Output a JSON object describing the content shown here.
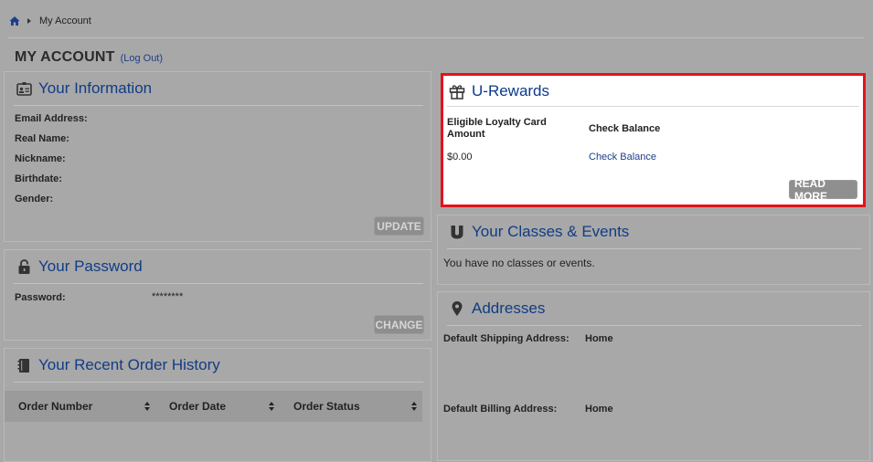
{
  "breadcrumb": {
    "current": "My Account"
  },
  "header": {
    "title": "MY ACCOUNT",
    "logout_label": "(Log Out)"
  },
  "your_information": {
    "title": "Your Information",
    "fields": [
      "Email Address:",
      "Real Name:",
      "Nickname:",
      "Birthdate:",
      "Gender:"
    ],
    "update_label": "UPDATE"
  },
  "your_password": {
    "title": "Your Password",
    "label": "Password:",
    "value": "********",
    "change_label": "CHANGE"
  },
  "order_history": {
    "title": "Your Recent Order History",
    "columns": [
      "Order Number",
      "Order Date",
      "Order Status"
    ]
  },
  "u_rewards": {
    "title": "U-Rewards",
    "col1_header": "Eligible Loyalty Card Amount",
    "col2_header": "Check Balance",
    "amount": "$0.00",
    "check_balance_link": "Check Balance",
    "read_more_label": "READ MORE"
  },
  "classes_events": {
    "title": "Your Classes & Events",
    "message": "You have no classes or events."
  },
  "addresses": {
    "title": "Addresses",
    "shipping_label": "Default Shipping Address:",
    "shipping_value": "Home",
    "billing_label": "Default Billing Address:",
    "billing_value": "Home"
  },
  "colors": {
    "heading_blue": "#113c86",
    "highlight_red": "#e3131c",
    "page_grey": "#a8a8a8"
  }
}
